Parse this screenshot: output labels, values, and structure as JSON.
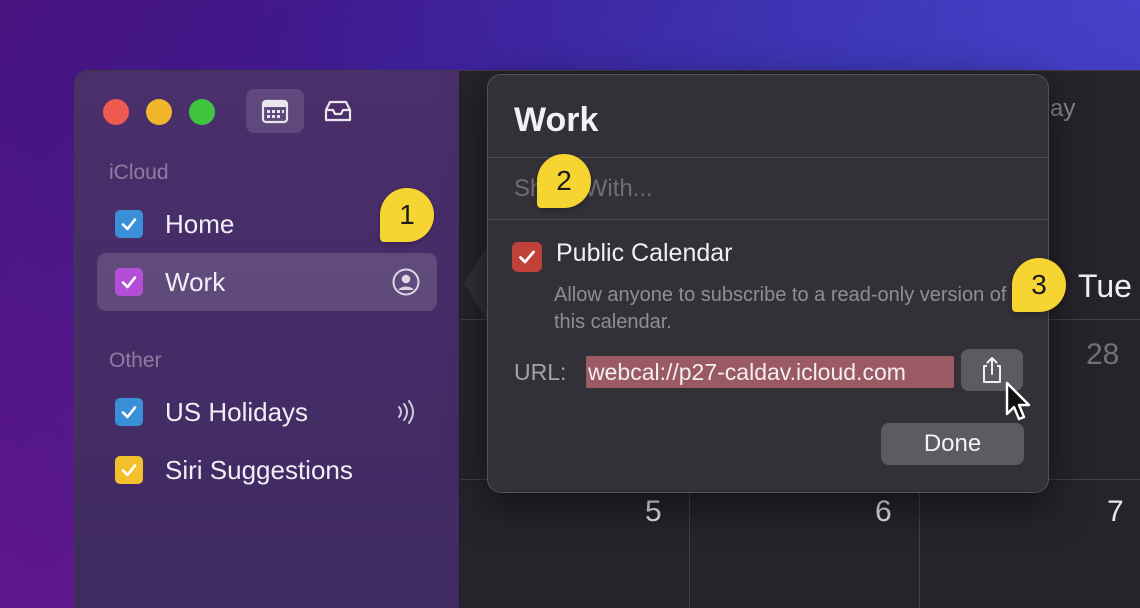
{
  "sidebar": {
    "sections": [
      {
        "label": "iCloud"
      },
      {
        "label": "Other"
      }
    ],
    "items": [
      {
        "name": "Home",
        "color": "#3a8fd9",
        "checked": true
      },
      {
        "name": "Work",
        "color": "#b24fd6",
        "checked": true,
        "selected": true,
        "shared_icon": "person-circle-icon"
      },
      {
        "name": "US Holidays",
        "color": "#3a8fd9",
        "checked": true,
        "subscribed_icon": "broadcast-icon"
      },
      {
        "name": "Siri Suggestions",
        "color": "#f3c12b",
        "checked": true
      }
    ]
  },
  "popover": {
    "title": "Work",
    "share_with_placeholder": "Share With...",
    "public_calendar": {
      "label": "Public Calendar",
      "checked": true,
      "description": "Allow anyone to subscribe to a read-only version of this calendar."
    },
    "url_label": "URL:",
    "url_value": "webcal://p27-caldav.icloud.com",
    "done_label": "Done"
  },
  "calendar": {
    "weekday_fragment": "ay",
    "weekday": "Tue",
    "dates": [
      "28",
      "5",
      "6",
      "7"
    ]
  },
  "annotations": [
    {
      "number": "1"
    },
    {
      "number": "2"
    },
    {
      "number": "3"
    }
  ],
  "colors": {
    "accent_red": "#c0413a",
    "badge_yellow": "#f6d431",
    "url_highlight": "#9a5a63"
  }
}
